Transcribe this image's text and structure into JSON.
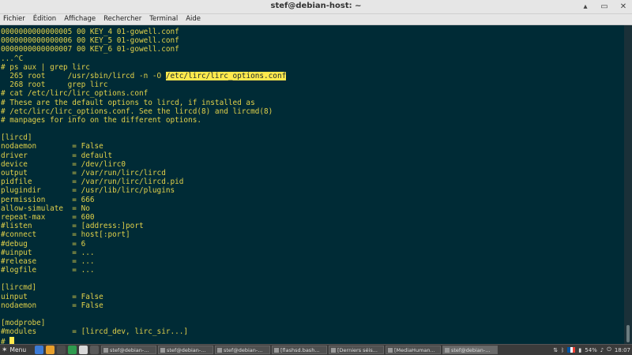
{
  "window": {
    "title": "stef@debian-host: ~",
    "minimize": "▴",
    "maximize": "▭",
    "close": "✕"
  },
  "menu": [
    "Fichier",
    "Édition",
    "Affichage",
    "Rechercher",
    "Terminal",
    "Aide"
  ],
  "terminal": {
    "lines": [
      "0000000000000005 00 KEY_4 01-gowell.conf",
      "0000000000000006 00 KEY_5 01-gowell.conf",
      "0000000000000007 00 KEY_6 01-gowell.conf",
      "...^C",
      "# ps aux | grep lirc",
      "  265 root     /usr/sbin/lircd -n -O /etc/lirc/lirc_options.conf",
      "  268 root     grep lirc",
      "# cat /etc/lirc/lirc_options.conf",
      "# These are the default options to lircd, if installed as",
      "# /etc/lirc/lirc_options.conf. See the lircd(8) and lircmd(8)",
      "# manpages for info on the different options.",
      "",
      "[lircd]",
      "nodaemon        = False",
      "driver          = default",
      "device          = /dev/lirc0",
      "output          = /var/run/lirc/lircd",
      "pidfile         = /var/run/lirc/lircd.pid",
      "plugindir       = /usr/lib/lirc/plugins",
      "permission      = 666",
      "allow-simulate  = No",
      "repeat-max      = 600",
      "#listen         = [address:]port",
      "#connect        = host[:port]",
      "#debug          = 6",
      "#uinput         = ...",
      "#release        = ...",
      "#logfile        = ...",
      "",
      "[lircmd]",
      "uinput          = False",
      "nodaemon        = False",
      "",
      "[modprobe]",
      "#modules        = [lircd_dev, lirc_sir...]",
      "# "
    ],
    "highlight": {
      "line": 5,
      "text": "/etc/lirc/lirc_options.conf"
    }
  },
  "taskbar": {
    "menu_label": "Menu",
    "launcher_colors": [
      "#3c7bd6",
      "#e8a02c",
      "#4c4c4c",
      "#2f9a4e",
      "#d9d9d9",
      "#5a5a5a"
    ],
    "tasks": [
      "stef@debian-...",
      "stef@debian-...",
      "stef@debian-...",
      "[flashsd.bash...",
      "[Derniers séis...",
      "[MediaHuman...",
      "stef@debian-..."
    ],
    "active_task": 6,
    "battery": "54%",
    "flag_colors": [
      "#0055a4",
      "#ffffff",
      "#ef4135"
    ],
    "clock": "18:07"
  }
}
